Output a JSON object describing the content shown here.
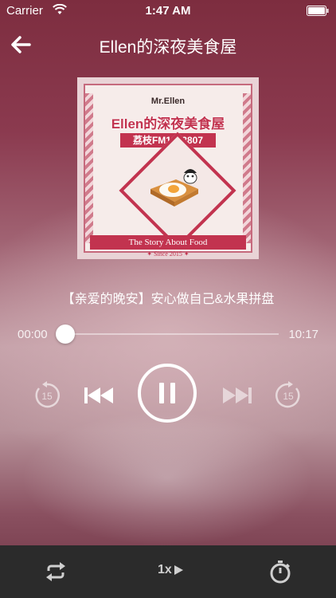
{
  "status_bar": {
    "carrier": "Carrier",
    "time": "1:47 AM"
  },
  "nav": {
    "title": "Ellen的深夜美食屋"
  },
  "cover": {
    "brand": "Mr.Ellen",
    "title": "Ellen的深夜美食屋",
    "fm": "荔枝FM1233807",
    "ribbon": "The Story About Food",
    "since": "✦ Since 2015 ✦"
  },
  "track": {
    "title": "【亲爱的晚安】安心做自己&水果拼盘"
  },
  "player": {
    "current_time": "00:00",
    "total_time": "10:17",
    "progress_fraction": 0.0,
    "skip_back_seconds": "15",
    "skip_forward_seconds": "15"
  },
  "toolbar": {
    "speed_label": "1x"
  },
  "icons": [
    "wifi-icon",
    "battery-icon",
    "back-icon",
    "rewind-15-icon",
    "previous-icon",
    "pause-icon",
    "next-icon",
    "forward-15-icon",
    "repeat-icon",
    "play-icon",
    "timer-icon"
  ],
  "colors": {
    "background": "#8a3a4e",
    "toolbar": "#2b2b2b",
    "accent": "#c2334f"
  }
}
